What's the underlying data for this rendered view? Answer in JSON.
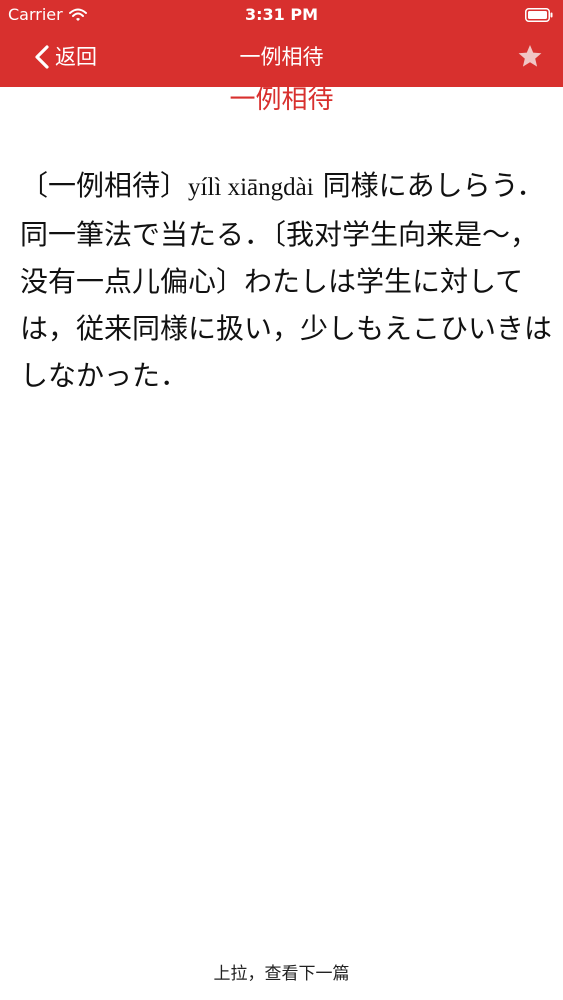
{
  "status_bar": {
    "carrier": "Carrier",
    "time": "3:31 PM",
    "icons": [
      "wifi-icon",
      "battery-icon"
    ]
  },
  "nav_bar": {
    "back_label": "返回",
    "title": "一例相待",
    "favorite_icon": "star-icon",
    "color": "#d8302e"
  },
  "entry": {
    "headword": "一例相待",
    "prefix": "〔一例相待〕",
    "pinyin": "yílì xiāngdài",
    "definition": "同様にあしらう．同一筆法で当たる．〔我对学生向来是～，没有一点儿偏心〕わたしは学生に対しては，従来同様に扱い，少しもえこひいきはしなかった．"
  },
  "footer": {
    "hint": "上拉，查看下一篇"
  }
}
